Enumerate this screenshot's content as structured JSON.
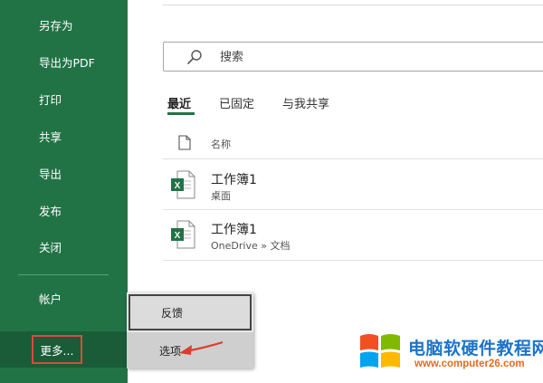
{
  "sidebar": {
    "items": [
      {
        "label": "另存为"
      },
      {
        "label": "导出为PDF"
      },
      {
        "label": "打印"
      },
      {
        "label": "共享"
      },
      {
        "label": "导出"
      },
      {
        "label": "发布"
      },
      {
        "label": "关闭"
      }
    ],
    "account_label": "帐户",
    "more_label": "更多...",
    "colors": {
      "background": "#217346",
      "highlight": "#1a5c38",
      "callout_border": "#d94b3d"
    }
  },
  "search": {
    "placeholder": "搜索",
    "icon": "search-icon"
  },
  "tabs": [
    {
      "label": "最近",
      "active": true
    },
    {
      "label": "已固定",
      "active": false
    },
    {
      "label": "与我共享",
      "active": false
    }
  ],
  "file_list": {
    "column_header": "名称",
    "header_icon": "document-icon",
    "rows": [
      {
        "name": "工作簿1",
        "location": "桌面",
        "icon": "excel-file-icon"
      },
      {
        "name": "工作簿1",
        "location": "OneDrive » 文档",
        "icon": "excel-file-icon"
      }
    ]
  },
  "popup_menu": {
    "items": [
      {
        "label": "反馈"
      },
      {
        "label": "选项"
      }
    ],
    "pointer": "red-arrow-icon"
  },
  "watermark": {
    "title": "电脑软硬件教程网",
    "url": "www.computer26.com"
  }
}
